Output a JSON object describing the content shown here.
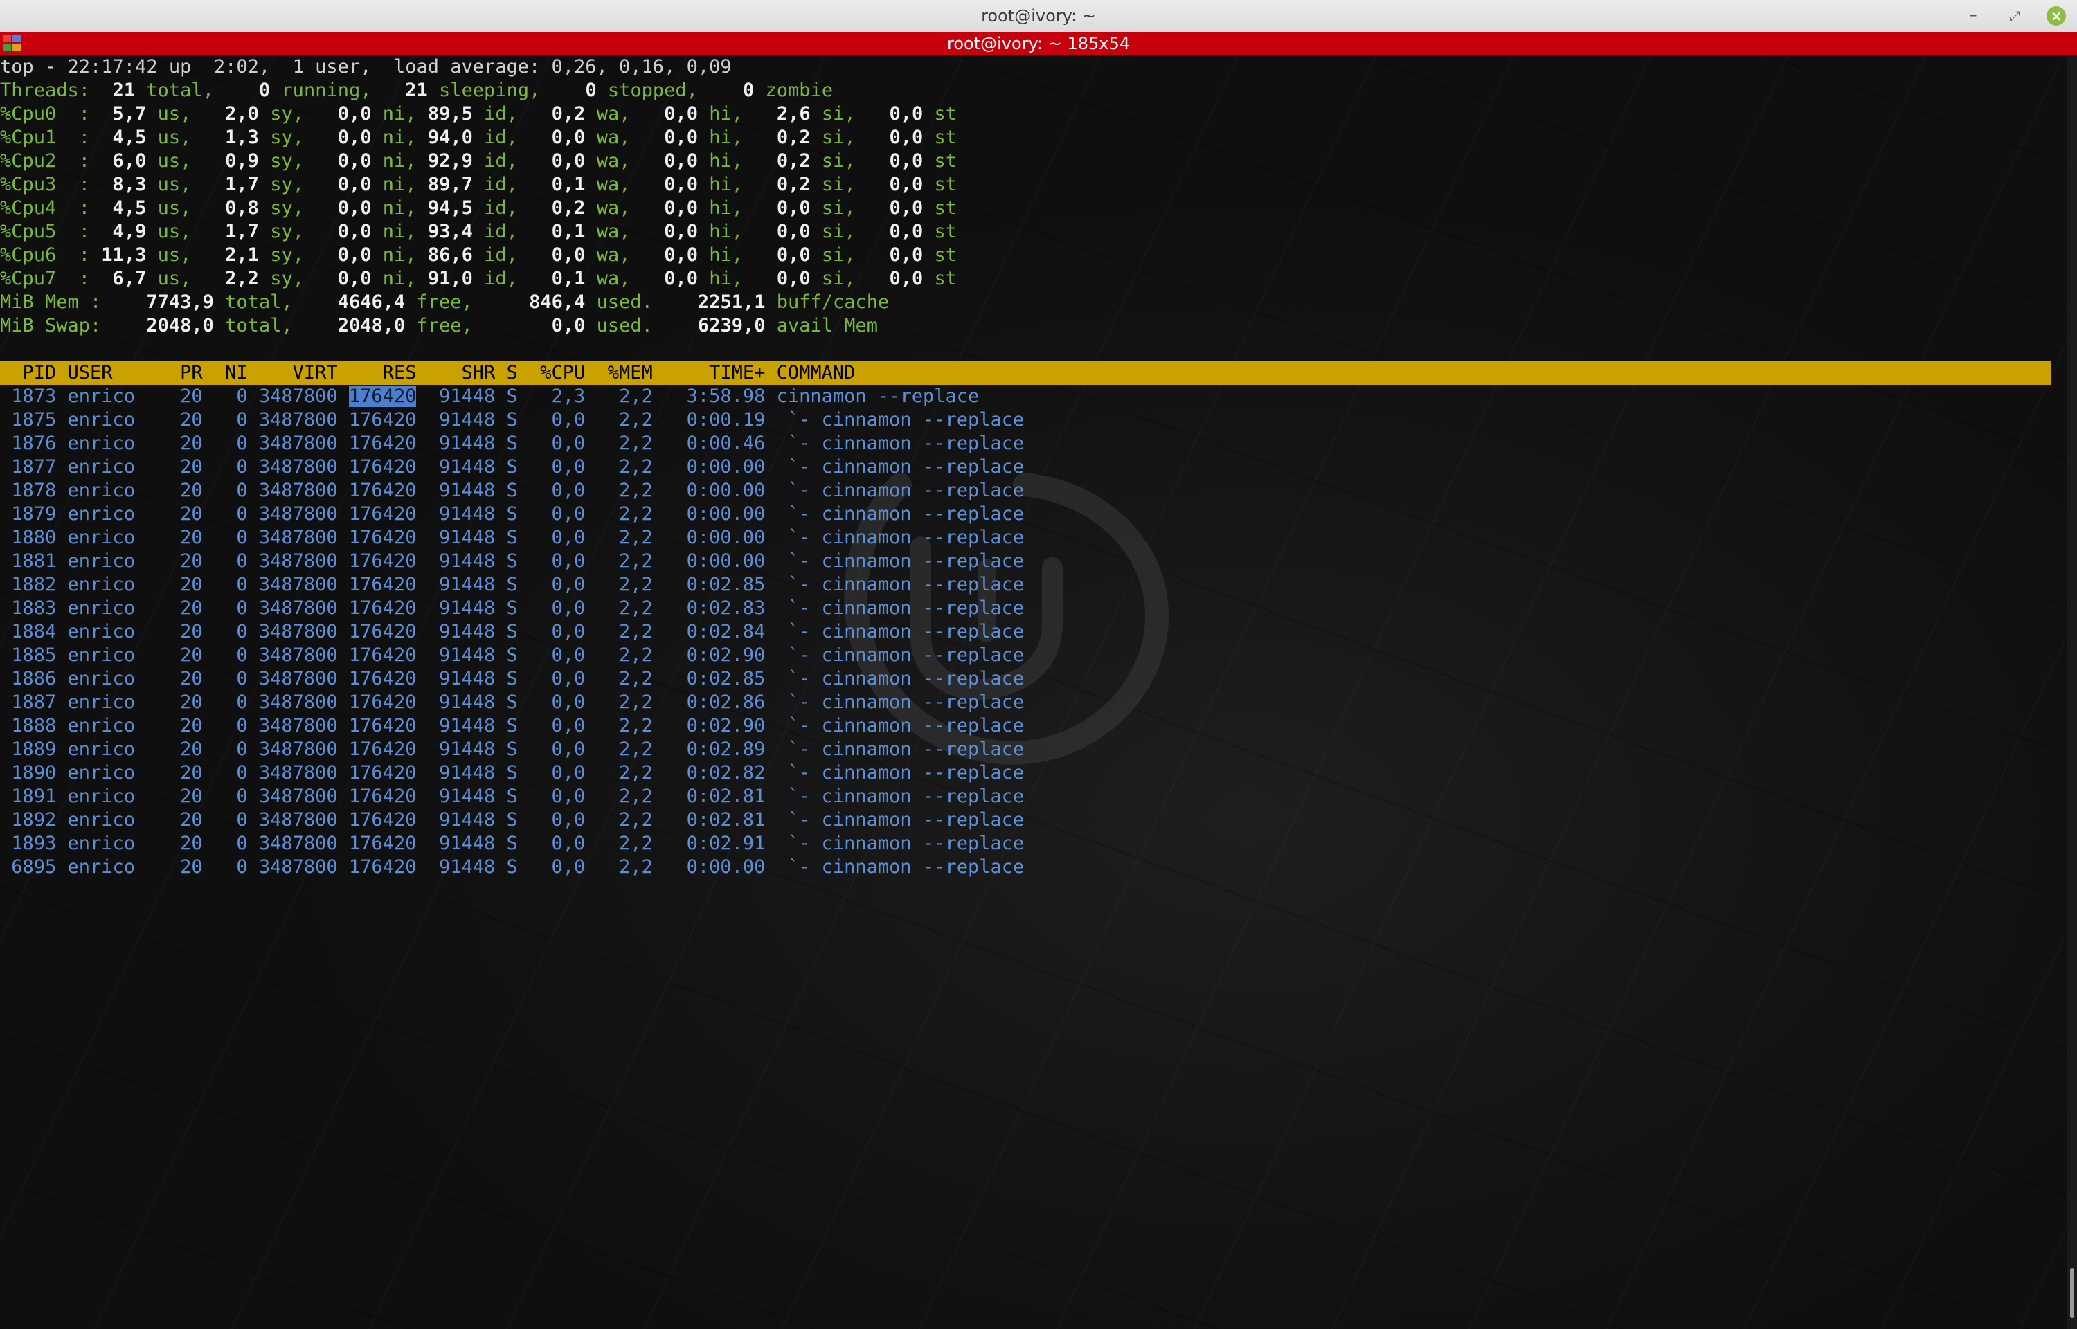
{
  "window": {
    "title": "root@ivory: ~",
    "tab_title": "root@ivory: ~ 185x54",
    "minimize_glyph": "–",
    "maximize_glyph": "⤢",
    "close_glyph": "×"
  },
  "summary": {
    "top_line": "top - 22:17:42 up  2:02,  1 user,  load average: 0,26, 0,16, 0,09",
    "threads": {
      "total": "21",
      "running": "0",
      "sleeping": "21",
      "stopped": "0",
      "zombie": "0"
    },
    "cpus": [
      {
        "name": "%Cpu0  :",
        "us": "5,7",
        "sy": "2,0",
        "ni": "0,0",
        "id": "89,5",
        "wa": "0,2",
        "hi": "0,0",
        "si": "2,6",
        "st": "0,0"
      },
      {
        "name": "%Cpu1  :",
        "us": "4,5",
        "sy": "1,3",
        "ni": "0,0",
        "id": "94,0",
        "wa": "0,0",
        "hi": "0,0",
        "si": "0,2",
        "st": "0,0"
      },
      {
        "name": "%Cpu2  :",
        "us": "6,0",
        "sy": "0,9",
        "ni": "0,0",
        "id": "92,9",
        "wa": "0,0",
        "hi": "0,0",
        "si": "0,2",
        "st": "0,0"
      },
      {
        "name": "%Cpu3  :",
        "us": "8,3",
        "sy": "1,7",
        "ni": "0,0",
        "id": "89,7",
        "wa": "0,1",
        "hi": "0,0",
        "si": "0,2",
        "st": "0,0"
      },
      {
        "name": "%Cpu4  :",
        "us": "4,5",
        "sy": "0,8",
        "ni": "0,0",
        "id": "94,5",
        "wa": "0,2",
        "hi": "0,0",
        "si": "0,0",
        "st": "0,0"
      },
      {
        "name": "%Cpu5  :",
        "us": "4,9",
        "sy": "1,7",
        "ni": "0,0",
        "id": "93,4",
        "wa": "0,1",
        "hi": "0,0",
        "si": "0,0",
        "st": "0,0"
      },
      {
        "name": "%Cpu6  :",
        "us": "11,3",
        "sy": "2,1",
        "ni": "0,0",
        "id": "86,6",
        "wa": "0,0",
        "hi": "0,0",
        "si": "0,0",
        "st": "0,0"
      },
      {
        "name": "%Cpu7  :",
        "us": "6,7",
        "sy": "2,2",
        "ni": "0,0",
        "id": "91,0",
        "wa": "0,1",
        "hi": "0,0",
        "si": "0,0",
        "st": "0,0"
      }
    ],
    "mem": {
      "label": "MiB Mem :",
      "total": "7743,9",
      "free": "4646,4",
      "used": "846,4",
      "buff": "2251,1"
    },
    "swap": {
      "label": "MiB Swap:",
      "total": "2048,0",
      "free": "2048,0",
      "used": "0,0",
      "avail": "6239,0"
    }
  },
  "table": {
    "header": "  PID USER      PR  NI    VIRT    RES    SHR S  %CPU  %MEM     TIME+ COMMAND",
    "rows": [
      {
        "pid": "1873",
        "user": "enrico",
        "pr": "20",
        "ni": "0",
        "virt": "3487800",
        "res": "176420",
        "shr": "91448",
        "s": "S",
        "cpu": "2,3",
        "mem": "2,2",
        "time": "3:58.98",
        "cmd": "cinnamon --replace"
      },
      {
        "pid": "1875",
        "user": "enrico",
        "pr": "20",
        "ni": "0",
        "virt": "3487800",
        "res": "176420",
        "shr": "91448",
        "s": "S",
        "cpu": "0,0",
        "mem": "2,2",
        "time": "0:00.19",
        "cmd": " `- cinnamon --replace"
      },
      {
        "pid": "1876",
        "user": "enrico",
        "pr": "20",
        "ni": "0",
        "virt": "3487800",
        "res": "176420",
        "shr": "91448",
        "s": "S",
        "cpu": "0,0",
        "mem": "2,2",
        "time": "0:00.46",
        "cmd": " `- cinnamon --replace"
      },
      {
        "pid": "1877",
        "user": "enrico",
        "pr": "20",
        "ni": "0",
        "virt": "3487800",
        "res": "176420",
        "shr": "91448",
        "s": "S",
        "cpu": "0,0",
        "mem": "2,2",
        "time": "0:00.00",
        "cmd": " `- cinnamon --replace"
      },
      {
        "pid": "1878",
        "user": "enrico",
        "pr": "20",
        "ni": "0",
        "virt": "3487800",
        "res": "176420",
        "shr": "91448",
        "s": "S",
        "cpu": "0,0",
        "mem": "2,2",
        "time": "0:00.00",
        "cmd": " `- cinnamon --replace"
      },
      {
        "pid": "1879",
        "user": "enrico",
        "pr": "20",
        "ni": "0",
        "virt": "3487800",
        "res": "176420",
        "shr": "91448",
        "s": "S",
        "cpu": "0,0",
        "mem": "2,2",
        "time": "0:00.00",
        "cmd": " `- cinnamon --replace"
      },
      {
        "pid": "1880",
        "user": "enrico",
        "pr": "20",
        "ni": "0",
        "virt": "3487800",
        "res": "176420",
        "shr": "91448",
        "s": "S",
        "cpu": "0,0",
        "mem": "2,2",
        "time": "0:00.00",
        "cmd": " `- cinnamon --replace"
      },
      {
        "pid": "1881",
        "user": "enrico",
        "pr": "20",
        "ni": "0",
        "virt": "3487800",
        "res": "176420",
        "shr": "91448",
        "s": "S",
        "cpu": "0,0",
        "mem": "2,2",
        "time": "0:00.00",
        "cmd": " `- cinnamon --replace"
      },
      {
        "pid": "1882",
        "user": "enrico",
        "pr": "20",
        "ni": "0",
        "virt": "3487800",
        "res": "176420",
        "shr": "91448",
        "s": "S",
        "cpu": "0,0",
        "mem": "2,2",
        "time": "0:02.85",
        "cmd": " `- cinnamon --replace"
      },
      {
        "pid": "1883",
        "user": "enrico",
        "pr": "20",
        "ni": "0",
        "virt": "3487800",
        "res": "176420",
        "shr": "91448",
        "s": "S",
        "cpu": "0,0",
        "mem": "2,2",
        "time": "0:02.83",
        "cmd": " `- cinnamon --replace"
      },
      {
        "pid": "1884",
        "user": "enrico",
        "pr": "20",
        "ni": "0",
        "virt": "3487800",
        "res": "176420",
        "shr": "91448",
        "s": "S",
        "cpu": "0,0",
        "mem": "2,2",
        "time": "0:02.84",
        "cmd": " `- cinnamon --replace"
      },
      {
        "pid": "1885",
        "user": "enrico",
        "pr": "20",
        "ni": "0",
        "virt": "3487800",
        "res": "176420",
        "shr": "91448",
        "s": "S",
        "cpu": "0,0",
        "mem": "2,2",
        "time": "0:02.90",
        "cmd": " `- cinnamon --replace"
      },
      {
        "pid": "1886",
        "user": "enrico",
        "pr": "20",
        "ni": "0",
        "virt": "3487800",
        "res": "176420",
        "shr": "91448",
        "s": "S",
        "cpu": "0,0",
        "mem": "2,2",
        "time": "0:02.85",
        "cmd": " `- cinnamon --replace"
      },
      {
        "pid": "1887",
        "user": "enrico",
        "pr": "20",
        "ni": "0",
        "virt": "3487800",
        "res": "176420",
        "shr": "91448",
        "s": "S",
        "cpu": "0,0",
        "mem": "2,2",
        "time": "0:02.86",
        "cmd": " `- cinnamon --replace"
      },
      {
        "pid": "1888",
        "user": "enrico",
        "pr": "20",
        "ni": "0",
        "virt": "3487800",
        "res": "176420",
        "shr": "91448",
        "s": "S",
        "cpu": "0,0",
        "mem": "2,2",
        "time": "0:02.90",
        "cmd": " `- cinnamon --replace"
      },
      {
        "pid": "1889",
        "user": "enrico",
        "pr": "20",
        "ni": "0",
        "virt": "3487800",
        "res": "176420",
        "shr": "91448",
        "s": "S",
        "cpu": "0,0",
        "mem": "2,2",
        "time": "0:02.89",
        "cmd": " `- cinnamon --replace"
      },
      {
        "pid": "1890",
        "user": "enrico",
        "pr": "20",
        "ni": "0",
        "virt": "3487800",
        "res": "176420",
        "shr": "91448",
        "s": "S",
        "cpu": "0,0",
        "mem": "2,2",
        "time": "0:02.82",
        "cmd": " `- cinnamon --replace"
      },
      {
        "pid": "1891",
        "user": "enrico",
        "pr": "20",
        "ni": "0",
        "virt": "3487800",
        "res": "176420",
        "shr": "91448",
        "s": "S",
        "cpu": "0,0",
        "mem": "2,2",
        "time": "0:02.81",
        "cmd": " `- cinnamon --replace"
      },
      {
        "pid": "1892",
        "user": "enrico",
        "pr": "20",
        "ni": "0",
        "virt": "3487800",
        "res": "176420",
        "shr": "91448",
        "s": "S",
        "cpu": "0,0",
        "mem": "2,2",
        "time": "0:02.81",
        "cmd": " `- cinnamon --replace"
      },
      {
        "pid": "1893",
        "user": "enrico",
        "pr": "20",
        "ni": "0",
        "virt": "3487800",
        "res": "176420",
        "shr": "91448",
        "s": "S",
        "cpu": "0,0",
        "mem": "2,2",
        "time": "0:02.91",
        "cmd": " `- cinnamon --replace"
      },
      {
        "pid": "6895",
        "user": "enrico",
        "pr": "20",
        "ni": "0",
        "virt": "3487800",
        "res": "176420",
        "shr": "91448",
        "s": "S",
        "cpu": "0,0",
        "mem": "2,2",
        "time": "0:00.00",
        "cmd": " `- cinnamon --replace"
      }
    ]
  },
  "colors": {
    "title_red": "#c8000b",
    "header_yellow": "#c9a100",
    "label_green": "#79b93c",
    "row_blue": "#5d8fd6"
  }
}
